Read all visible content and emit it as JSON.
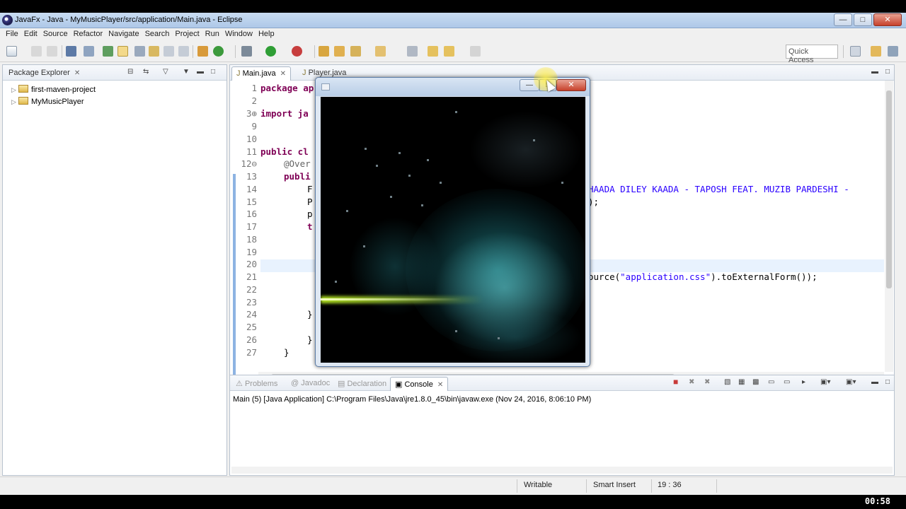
{
  "window": {
    "title": "JavaFx - Java - MyMusicPlayer/src/application/Main.java - Eclipse",
    "controls": {
      "minimize": "—",
      "maximize": "□",
      "close": "✕"
    }
  },
  "menubar": [
    "File",
    "Edit",
    "Source",
    "Refactor",
    "Navigate",
    "Search",
    "Project",
    "Run",
    "Window",
    "Help"
  ],
  "toolbar": {
    "quick_access": "Quick Access"
  },
  "package_explorer": {
    "tab_label": "Package Explorer",
    "projects": [
      "first-maven-project",
      "MyMusicPlayer"
    ]
  },
  "editor": {
    "tabs": [
      "Main.java",
      "Player.java"
    ],
    "line_numbers": [
      "1",
      "2",
      "3⊕",
      "9",
      "10",
      "11",
      "12⊖",
      "13",
      "14",
      "15",
      "16",
      "17",
      "18",
      "19",
      "20",
      "21",
      "22",
      "23",
      "24",
      "25",
      "26",
      "27"
    ],
    "visible_code": {
      "l1": "package ap",
      "l3": "import ja",
      "l11": "public cl",
      "l12": "@Over",
      "l13": "publi",
      "l14_left": "F",
      "l14_right": "HAADA DILEY KAADA - TAPOSH FEAT. MUZIB PARDESHI -",
      "l15_left": "P",
      "l15_right": ");",
      "l16_left": "p",
      "l17_left": "t",
      "l21_right_prefix": "ource(",
      "l21_string": "\"application.css\"",
      "l21_right_suffix": ").toExternalForm());",
      "l24": "}",
      "l26": "}",
      "l27": "}"
    }
  },
  "console_panel": {
    "tabs": [
      "Problems",
      "Javadoc",
      "Declaration",
      "Console"
    ],
    "launch_line": "Main (5) [Java Application] C:\\Program Files\\Java\\jre1.8.0_45\\bin\\javaw.exe (Nov 24, 2016, 8:06:10 PM)"
  },
  "statusbar": {
    "mode": "Writable",
    "insert": "Smart Insert",
    "position": "19 : 36"
  },
  "video_timer": "00:58",
  "colors": {
    "title_gradient": "#aec8e8",
    "keyword": "#7f0055",
    "string": "#2a00ff",
    "visualizer_glow": "#2fb7c0",
    "visualizer_streak": "#c8ff28"
  }
}
